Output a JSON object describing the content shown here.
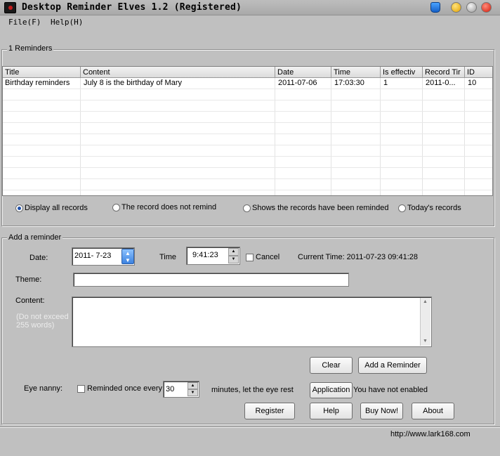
{
  "window": {
    "title": "Desktop Reminder Elves 1.2 (Registered)"
  },
  "menu": {
    "items": [
      {
        "label": "File(F)"
      },
      {
        "label": "Help(H)"
      }
    ]
  },
  "reminders": {
    "group_label": "1  Reminders",
    "columns": [
      "Title",
      "Content",
      "Date",
      "Time",
      "Is effectiv",
      "Record Tir",
      "ID"
    ],
    "rows": [
      {
        "title": "Birthday reminders",
        "content": "July 8 is the birthday of Mary",
        "date": "2011-07-06",
        "time": "17:03:30",
        "is_effective": "1",
        "record_time": "2011-0...",
        "id": "10"
      }
    ],
    "filters": [
      {
        "label": "Display all records",
        "selected": true
      },
      {
        "label": "The record does not remind",
        "selected": false
      },
      {
        "label": "Shows the records have been reminded",
        "selected": false
      },
      {
        "label": "Today's records",
        "selected": false
      }
    ]
  },
  "add": {
    "group_label": "Add a reminder",
    "date_label": "Date:",
    "date_value": "2011- 7-23",
    "time_label": "Time",
    "time_value": "9:41:23",
    "cancel_label": "Cancel",
    "current_time": "Current Time: 2011-07-23 09:41:28",
    "theme_label": "Theme:",
    "theme_value": "",
    "content_label": "Content:",
    "content_hint": "(Do not exceed 255 words)",
    "content_value": "",
    "clear_button": "Clear",
    "add_button": "Add a Reminder"
  },
  "eye": {
    "label": "Eye nanny:",
    "check_label": "Reminded once every",
    "minutes_value": "30",
    "suffix": "minutes, let the eye rest",
    "application_button": "Application",
    "status": "You have not enabled"
  },
  "buttons": {
    "register": "Register",
    "help": "Help",
    "buy": "Buy Now!",
    "about": "About"
  },
  "footer": {
    "url": "http://www.lark168.com"
  },
  "colors": {
    "radio_selected": "#1e4fa8",
    "close_button": "#d21a0a",
    "minimize_button": "#e3a100"
  }
}
